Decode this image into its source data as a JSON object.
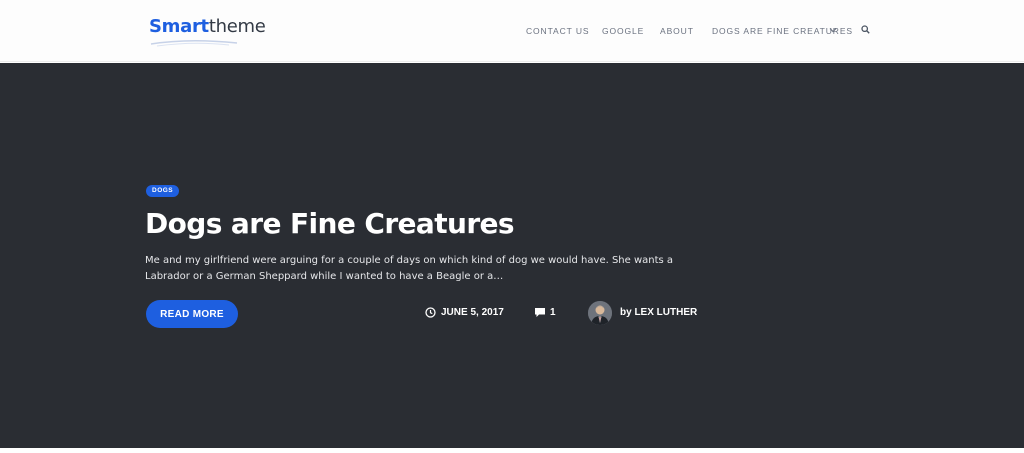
{
  "header": {
    "logo": {
      "part1": "Smart",
      "part2": "theme"
    },
    "nav": {
      "contact": "CONTACT US",
      "google": "GOOGLE",
      "about": "ABOUT",
      "dogs": "DOGS ARE FINE CREATURES"
    },
    "icons": {
      "dropdown": "chevron-down-icon",
      "search": "search-icon"
    }
  },
  "hero": {
    "category": "DOGS",
    "title": "Dogs are Fine Creatures",
    "excerpt": "Me and my girlfriend were arguing for a couple of days on which kind of dog we would have. She wants a Labrador or a German Sheppard while I wanted to have a Beagle or a…",
    "read_more": "READ MORE",
    "date": "JUNE 5, 2017",
    "comments": "1",
    "author": "by LEX LUTHER",
    "icons": {
      "date": "clock-icon",
      "comments": "comment-icon"
    }
  },
  "colors": {
    "accent": "#1e5fe0",
    "hero_bg": "#2a2d33",
    "nav_text": "#6b7280"
  }
}
